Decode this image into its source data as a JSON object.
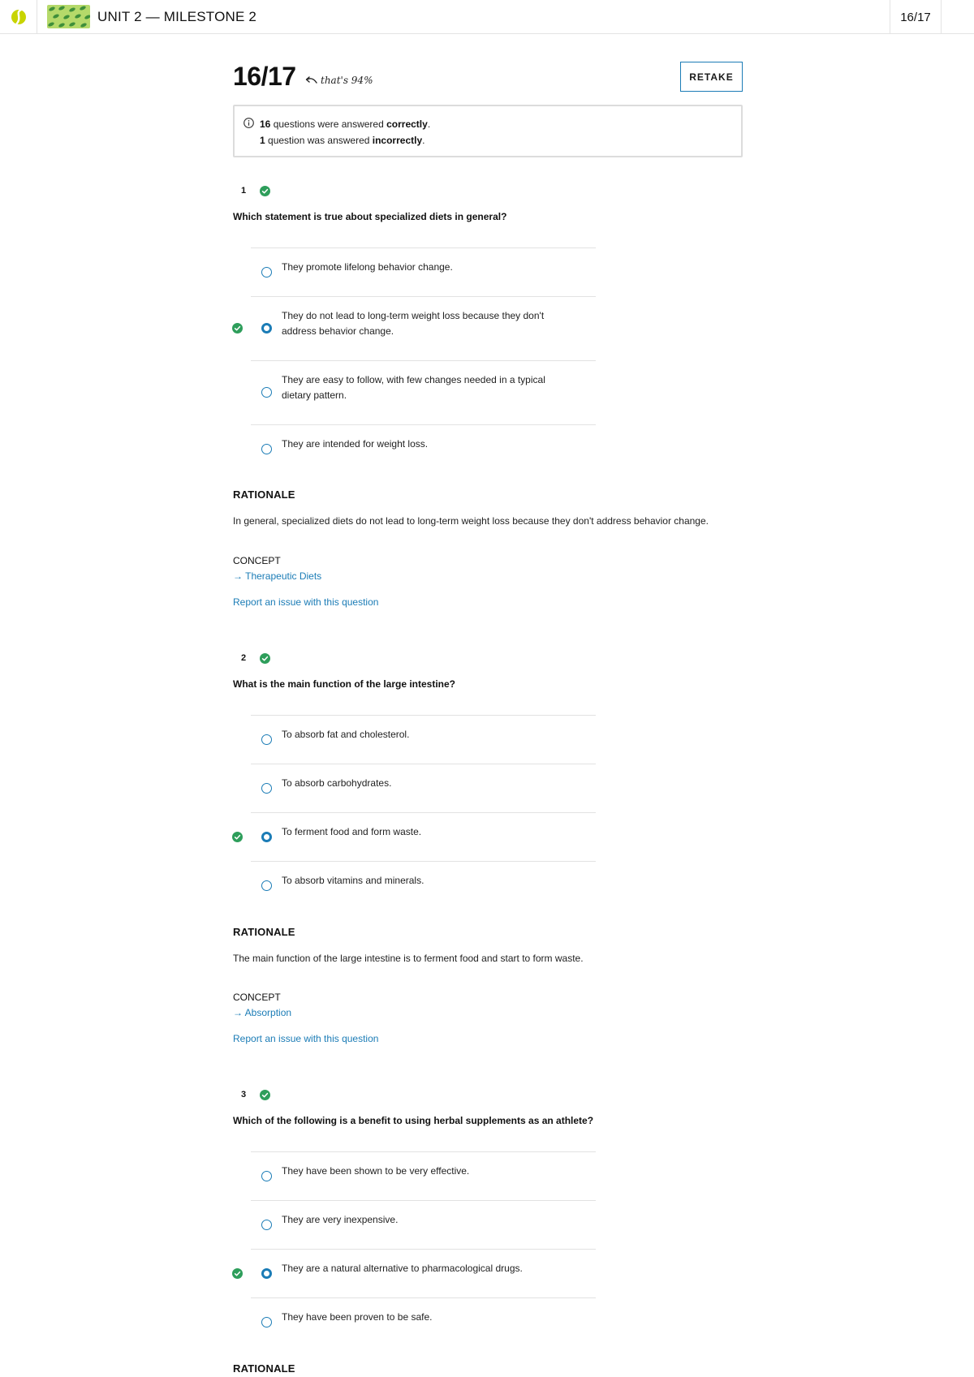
{
  "header": {
    "title": "UNIT 2 — MILESTONE 2",
    "score": "16/17"
  },
  "result": {
    "score": "16/17",
    "annotation": "that's 94%",
    "retake_label": "RETAKE",
    "correct_count": "16",
    "correct_text": " questions were answered ",
    "correct_word": "correctly",
    "incorrect_count": "1",
    "incorrect_text": " question was answered ",
    "incorrect_word": "incorrectly",
    "period": "."
  },
  "questions": [
    {
      "number": "1",
      "text": "Which statement is true about specialized diets in general?",
      "options": [
        "They promote lifelong behavior change.",
        "They do not lead to long-term weight loss because they don't address behavior change.",
        "They are easy to follow, with few changes needed in a typical dietary pattern.",
        "They are intended for weight loss."
      ],
      "rationale_label": "RATIONALE",
      "rationale": "In general, specialized diets do not lead to long-term weight loss because they don't address behavior change.",
      "concept_label": "CONCEPT",
      "concept": "Therapeutic Diets",
      "report": "Report an issue with this question"
    },
    {
      "number": "2",
      "text": "What is the main function of the large intestine?",
      "options": [
        "To absorb fat and cholesterol.",
        "To absorb carbohydrates.",
        "To ferment food and form waste.",
        "To absorb vitamins and minerals."
      ],
      "rationale_label": "RATIONALE",
      "rationale": "The main function of the large intestine is to ferment food and start to form waste.",
      "concept_label": "CONCEPT",
      "concept": "Absorption",
      "report": "Report an issue with this question"
    },
    {
      "number": "3",
      "text": "Which of the following is a benefit to using herbal supplements as an athlete?",
      "options": [
        "They have been shown to be very effective.",
        "They are very inexpensive.",
        "They are a natural alternative to pharmacological drugs.",
        "They have been proven to be safe."
      ],
      "rationale_label": "RATIONALE"
    }
  ],
  "colors": {
    "accent": "#1b7cb6",
    "correct_green": "#2e9e5b",
    "logo_green": "#c8d400"
  }
}
